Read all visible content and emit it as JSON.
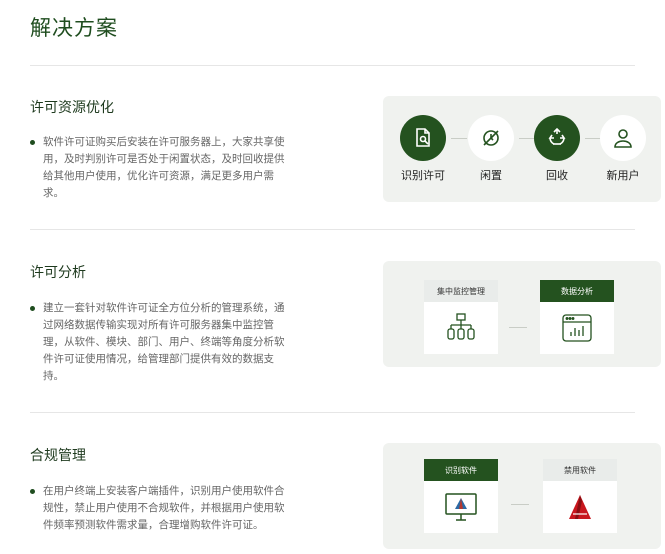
{
  "page": {
    "title": "解决方案"
  },
  "sections": [
    {
      "title": "许可资源优化",
      "text": "软件许可证购买后安装在许可服务器上，大家共享使用，及时判别许可是否处于闲置状态，及时回收提供给其他用户使用，优化许可资源，满足更多用户需求。"
    },
    {
      "title": "许可分析",
      "text": "建立一套针对软件许可证全方位分析的管理系统，通过网络数据传输实现对所有许可服务器集中监控管理，从软件、模块、部门、用户、终端等角度分析软件许可证使用情况，给管理部门提供有效的数据支持。"
    },
    {
      "title": "合规管理",
      "text": "在用户终端上安装客户端插件，识别用户使用软件合规性，禁止用户使用不合规软件，并根据用户使用软件频率预测软件需求量，合理增购软件许可证。"
    }
  ],
  "flow": [
    {
      "label": "识别许可",
      "icon": "document-search-icon",
      "style": "dark"
    },
    {
      "label": "闲置",
      "icon": "disabled-clock-icon",
      "style": "light"
    },
    {
      "label": "回收",
      "icon": "recycle-icon",
      "style": "dark"
    },
    {
      "label": "新用户",
      "icon": "user-icon",
      "style": "light"
    }
  ],
  "analysis_cards": [
    {
      "label": "集中监控管理",
      "icon": "network-tree-icon"
    },
    {
      "label": "数据分析",
      "icon": "chart-window-icon"
    }
  ],
  "compliance_cards": [
    {
      "label": "识别软件",
      "icon": "monitor-app-icon"
    },
    {
      "label": "禁用软件",
      "icon": "autocad-logo-icon"
    }
  ],
  "colors": {
    "brand": "#24521f",
    "panel_bg": "#f0f2ef",
    "text": "#666666"
  }
}
